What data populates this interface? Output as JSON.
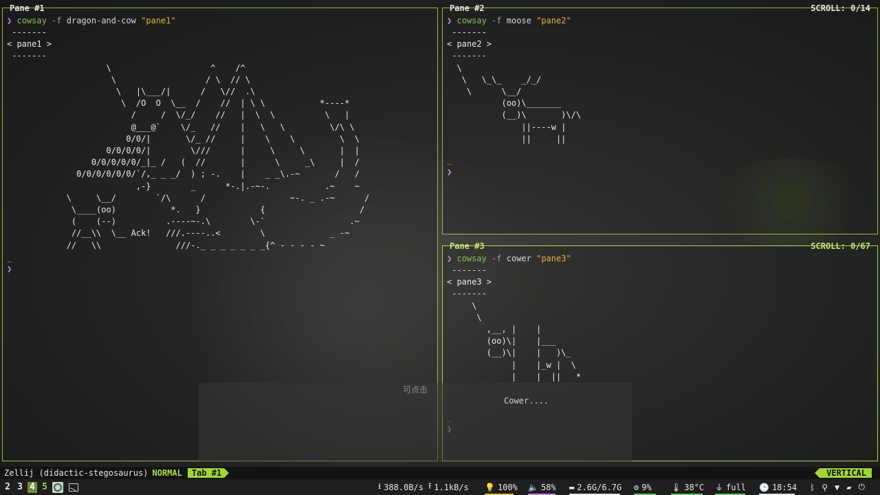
{
  "panes": [
    {
      "title": "Pane #1",
      "command": {
        "prompt": "❯",
        "cmd": "cowsay",
        "flag": "-f",
        "arg": "dragon-and-cow",
        "str": "\"pane1\""
      },
      "art": " -------\n< pane1 >\n -------\n                    \\                    ^    /^\n                     \\                  / \\  // \\\n                      \\   |\\___/|      /   \\//  .\\\n                       \\  /O  O  \\__  /    //  | \\ \\           *----*\n                         /     /  \\/_/    //   |  \\  \\          \\   |\n                         @___@`    \\/_   //    |   \\   \\         \\/\\ \\\n                        0/0/|       \\/_ //     |    \\    \\         \\  \\\n                    0/0/0/0/|        \\///      |     \\     \\       |  |\n                 0/0/0/0/0/_|_ /   (  //       |      \\     _\\     |  /\n              0/0/0/0/0/0/`/,_ _ _/  ) ; -.    |    _ _\\.-~       /   /\n                          ,-}        _      *-.|.-~-.           .~    ~\n            \\     \\__/        `/\\      /                 ~-. _ .-~      /\n             \\____(oo)           *.   }            {                   /\n             (    (--)          .----~-.\\        \\-`                 .~\n             //__\\\\  \\__ Ack!   ///.----..<        \\             _ -~\n            //   \\\\               ///-._ _ _ _ _ _ _{^ - - - - ~",
      "tilde": "~",
      "caret": "❯"
    },
    {
      "title": "Pane #2",
      "scroll": "SCROLL:  0/14",
      "command": {
        "prompt": "❯",
        "cmd": "cowsay",
        "flag": "-f",
        "arg": "moose",
        "str": "\"pane2\""
      },
      "art": " -------\n< pane2 >\n -------\n  \\\n   \\   \\_\\_    _/_/\n    \\      \\__/\n           (oo)\\_______\n           (__)\\       )\\/\\\n               ||----w |\n               ||     ||",
      "tilde": "~",
      "caret": "❯"
    },
    {
      "title": "Pane #3",
      "scroll": "SCROLL:  0/67",
      "command": {
        "prompt": "❯",
        "cmd": "cowsay",
        "flag": "-f",
        "arg": "cower",
        "str": "\"pane3\""
      },
      "art": " -------\n< pane3 >\n -------\n     \\\n      \\\n        ,__, |    |\n        (oo)\\|    |___\n        (__)\\|    |   )\\_\n             |    |_w |  \\\n             |    |  ||   *",
      "tilde": "~",
      "caret": "❯"
    }
  ],
  "overlay": {
    "hint": "可点击",
    "text": "Cower...."
  },
  "statusbar": {
    "session": "Zellij (didactic-stegosaurus)",
    "mode": "NORMAL",
    "tab": "Tab #1",
    "layout": "VERTICAL"
  },
  "workspaces": [
    "2",
    "3",
    "4",
    "5"
  ],
  "modules": {
    "download": "388.0B/s",
    "upload": "1.1kB/s",
    "brightness": "100%",
    "volume": "58%",
    "memory": "2.6G/6.7G",
    "cpu": "9%",
    "temp": "38°C",
    "battery": "full",
    "clock": "18:54"
  },
  "colors": {
    "accent": "#9fd634",
    "border": "#9fb84a"
  }
}
